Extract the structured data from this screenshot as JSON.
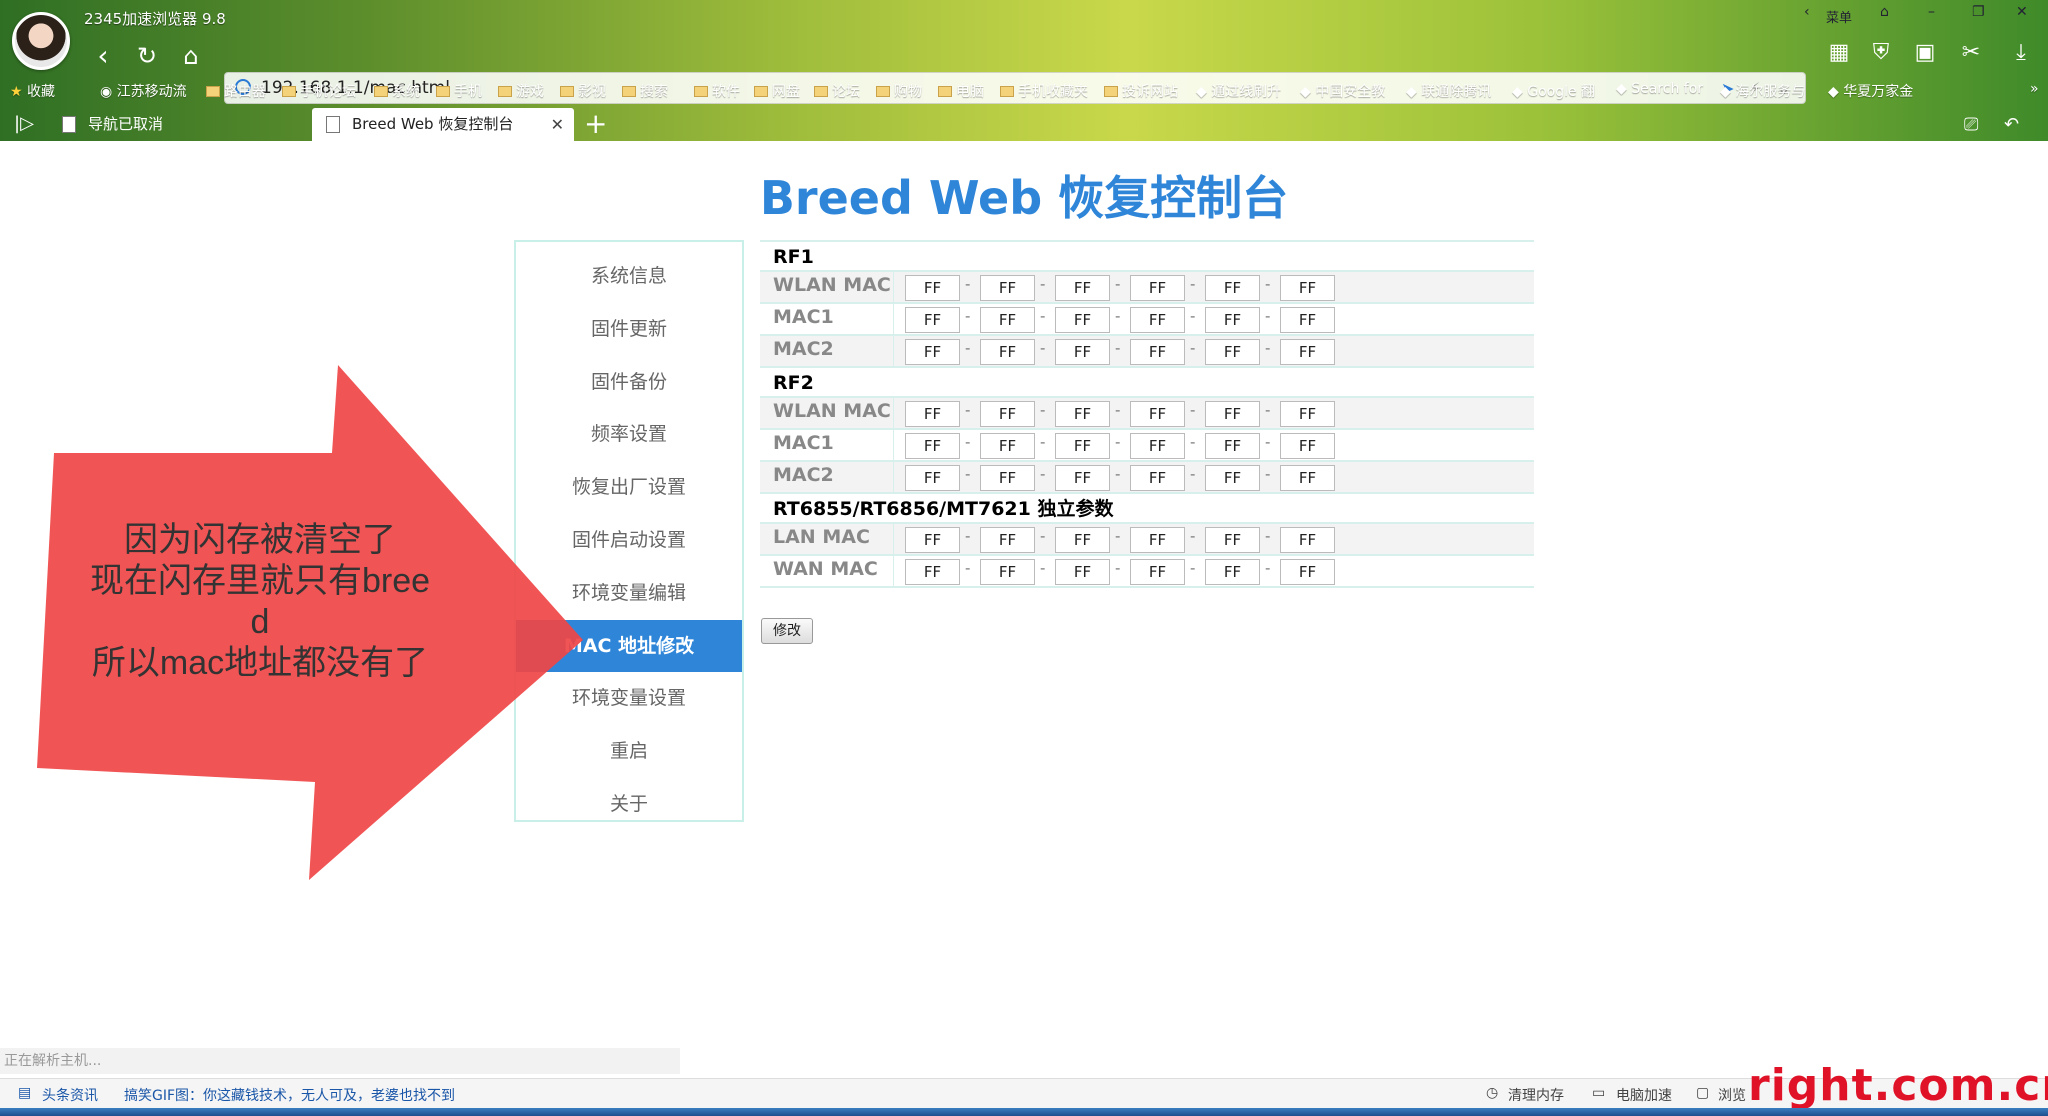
{
  "browser": {
    "app_title": "2345加速浏览器 9.8",
    "menu_label": "菜单",
    "url": "192.168.1.1/mac.html"
  },
  "bookmarks": [
    {
      "label": "收藏",
      "icon": "star-icon"
    },
    {
      "label": "江苏移动流",
      "icon": "globe-icon"
    },
    {
      "label": "路由器",
      "icon": "folder-icon"
    },
    {
      "label": "手机论坛",
      "icon": "folder-icon"
    },
    {
      "label": "系统",
      "icon": "folder-icon"
    },
    {
      "label": "手机",
      "icon": "folder-icon"
    },
    {
      "label": "游戏",
      "icon": "folder-icon"
    },
    {
      "label": "影视",
      "icon": "folder-icon"
    },
    {
      "label": "搜索",
      "icon": "folder-icon"
    },
    {
      "label": "软件",
      "icon": "folder-icon"
    },
    {
      "label": "网盘",
      "icon": "folder-icon"
    },
    {
      "label": "论坛",
      "icon": "folder-icon"
    },
    {
      "label": "购物",
      "icon": "folder-icon"
    },
    {
      "label": "电脑",
      "icon": "folder-icon"
    },
    {
      "label": "手机收藏夹",
      "icon": "folder-icon"
    },
    {
      "label": "投诉网站",
      "icon": "folder-icon"
    },
    {
      "label": "通过线刷升",
      "icon": "site-icon"
    },
    {
      "label": "中国安全教",
      "icon": "site-icon"
    },
    {
      "label": "联通除腾讯",
      "icon": "site-icon"
    },
    {
      "label": "Google 翻",
      "icon": "site-icon"
    },
    {
      "label": "Search for",
      "icon": "site-icon"
    },
    {
      "label": "海尔服务与",
      "icon": "site-icon"
    },
    {
      "label": "华夏万家金",
      "icon": "site-icon"
    }
  ],
  "tabs": [
    {
      "label": "导航已取消"
    },
    {
      "label": "Breed Web 恢复控制台"
    }
  ],
  "page": {
    "title": "Breed Web 恢复控制台",
    "menu": [
      "系统信息",
      "固件更新",
      "固件备份",
      "频率设置",
      "恢复出厂设置",
      "固件启动设置",
      "环境变量编辑",
      "MAC 地址修改",
      "环境变量设置",
      "重启",
      "关于"
    ],
    "active_menu_index": 7,
    "sections": [
      {
        "title": "RF1",
        "rows": [
          {
            "label": "WLAN MAC",
            "octets": [
              "FF",
              "FF",
              "FF",
              "FF",
              "FF",
              "FF"
            ]
          },
          {
            "label": "MAC1",
            "octets": [
              "FF",
              "FF",
              "FF",
              "FF",
              "FF",
              "FF"
            ]
          },
          {
            "label": "MAC2",
            "octets": [
              "FF",
              "FF",
              "FF",
              "FF",
              "FF",
              "FF"
            ]
          }
        ]
      },
      {
        "title": "RF2",
        "rows": [
          {
            "label": "WLAN MAC",
            "octets": [
              "FF",
              "FF",
              "FF",
              "FF",
              "FF",
              "FF"
            ]
          },
          {
            "label": "MAC1",
            "octets": [
              "FF",
              "FF",
              "FF",
              "FF",
              "FF",
              "FF"
            ]
          },
          {
            "label": "MAC2",
            "octets": [
              "FF",
              "FF",
              "FF",
              "FF",
              "FF",
              "FF"
            ]
          }
        ]
      },
      {
        "title": "RT6855/RT6856/MT7621 独立参数",
        "rows": [
          {
            "label": "LAN MAC",
            "octets": [
              "FF",
              "FF",
              "FF",
              "FF",
              "FF",
              "FF"
            ]
          },
          {
            "label": "WAN MAC",
            "octets": [
              "FF",
              "FF",
              "FF",
              "FF",
              "FF",
              "FF"
            ]
          }
        ]
      }
    ],
    "modify_button": "修改"
  },
  "annotation": {
    "lines": [
      "因为闪存被清空了",
      "现在闪存里就只有bree",
      "d",
      "所以mac地址都没有了"
    ],
    "color": "#f04545"
  },
  "status": {
    "loading": "正在解析主机...",
    "news_label": "头条资讯",
    "news_text": "搞笑GIF图：你这藏钱技术，无人可及，老婆也找不到",
    "clean_memory": "清理内存",
    "speed_up": "电脑加速",
    "browse": "浏览"
  },
  "watermark": "right.com.cn",
  "colors": {
    "accent": "#2f86d9",
    "table_border": "#d7f0ec",
    "menu_border": "#c9efe9"
  }
}
